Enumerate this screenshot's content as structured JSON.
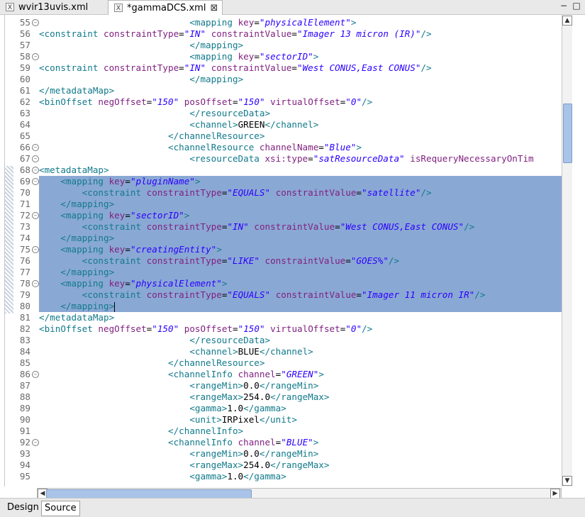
{
  "tabs": [
    {
      "label": "wvir13uvis.xml",
      "active": false
    },
    {
      "label": "*gammaDCS.xml",
      "active": true
    }
  ],
  "window_controls": [
    "minimize",
    "maximize"
  ],
  "bottom_tabs": [
    {
      "label": "Design",
      "active": false
    },
    {
      "label": "Source",
      "active": true
    }
  ],
  "editor": {
    "selection": {
      "from_line": 69,
      "to_line": 80
    },
    "caret_line": 80,
    "lines": [
      {
        "n": "55",
        "fold": true,
        "sel": false,
        "i": 28,
        "t": [
          [
            "t-tag",
            "<mapping "
          ],
          [
            "t-attr",
            "key"
          ],
          [
            "t-txt",
            "="
          ],
          [
            "t-val",
            "\"physicalElement\""
          ],
          [
            "t-tag",
            ">"
          ]
        ]
      },
      {
        "n": "56",
        "fold": false,
        "sel": false,
        "i": 0,
        "t": [
          [
            "t-tag",
            "<constraint "
          ],
          [
            "t-attr",
            "constraintType"
          ],
          [
            "t-txt",
            "="
          ],
          [
            "t-val",
            "\"IN\""
          ],
          [
            "t-txt",
            " "
          ],
          [
            "t-attr",
            "constraintValue"
          ],
          [
            "t-txt",
            "="
          ],
          [
            "t-val",
            "\"Imager 13 micron (IR)\""
          ],
          [
            "t-tag",
            "/>"
          ]
        ]
      },
      {
        "n": "57",
        "fold": false,
        "sel": false,
        "i": 28,
        "t": [
          [
            "t-tag",
            "</mapping>"
          ]
        ]
      },
      {
        "n": "58",
        "fold": true,
        "sel": false,
        "i": 28,
        "t": [
          [
            "t-tag",
            "<mapping "
          ],
          [
            "t-attr",
            "key"
          ],
          [
            "t-txt",
            "="
          ],
          [
            "t-val",
            "\"sectorID\""
          ],
          [
            "t-tag",
            ">"
          ]
        ]
      },
      {
        "n": "59",
        "fold": false,
        "sel": false,
        "i": 0,
        "t": [
          [
            "t-tag",
            "<constraint "
          ],
          [
            "t-attr",
            "constraintType"
          ],
          [
            "t-txt",
            "="
          ],
          [
            "t-val",
            "\"IN\""
          ],
          [
            "t-txt",
            " "
          ],
          [
            "t-attr",
            "constraintValue"
          ],
          [
            "t-txt",
            "="
          ],
          [
            "t-val",
            "\"West CONUS,East CONUS\""
          ],
          [
            "t-tag",
            "/>"
          ]
        ]
      },
      {
        "n": "60",
        "fold": false,
        "sel": false,
        "i": 28,
        "t": [
          [
            "t-tag",
            "</mapping>"
          ]
        ]
      },
      {
        "n": "61",
        "fold": false,
        "sel": false,
        "i": 0,
        "t": [
          [
            "t-tag",
            "</metadataMap>"
          ]
        ]
      },
      {
        "n": "62",
        "fold": false,
        "sel": false,
        "i": 0,
        "t": [
          [
            "t-tag",
            "<binOffset "
          ],
          [
            "t-attr",
            "negOffset"
          ],
          [
            "t-txt",
            "="
          ],
          [
            "t-val",
            "\"150\""
          ],
          [
            "t-txt",
            " "
          ],
          [
            "t-attr",
            "posOffset"
          ],
          [
            "t-txt",
            "="
          ],
          [
            "t-val",
            "\"150\""
          ],
          [
            "t-txt",
            " "
          ],
          [
            "t-attr",
            "virtualOffset"
          ],
          [
            "t-txt",
            "="
          ],
          [
            "t-val",
            "\"0\""
          ],
          [
            "t-tag",
            "/>"
          ]
        ]
      },
      {
        "n": "63",
        "fold": false,
        "sel": false,
        "i": 28,
        "t": [
          [
            "t-tag",
            "</resourceData>"
          ]
        ]
      },
      {
        "n": "64",
        "fold": false,
        "sel": false,
        "i": 28,
        "t": [
          [
            "t-tag",
            "<channel>"
          ],
          [
            "t-txt",
            "GREEN"
          ],
          [
            "t-tag",
            "</channel>"
          ]
        ]
      },
      {
        "n": "65",
        "fold": false,
        "sel": false,
        "i": 24,
        "t": [
          [
            "t-tag",
            "</channelResource>"
          ]
        ]
      },
      {
        "n": "66",
        "fold": true,
        "sel": false,
        "i": 24,
        "t": [
          [
            "t-tag",
            "<channelResource "
          ],
          [
            "t-attr",
            "channelName"
          ],
          [
            "t-txt",
            "="
          ],
          [
            "t-val",
            "\"Blue\""
          ],
          [
            "t-tag",
            ">"
          ]
        ]
      },
      {
        "n": "67",
        "fold": true,
        "sel": false,
        "i": 28,
        "t": [
          [
            "t-tag",
            "<resourceData "
          ],
          [
            "t-attr",
            "xsi:type"
          ],
          [
            "t-txt",
            "="
          ],
          [
            "t-val",
            "\"satResourceData\""
          ],
          [
            "t-txt",
            " "
          ],
          [
            "t-attr",
            "isRequeryNecessaryOnTim"
          ]
        ]
      },
      {
        "n": "68",
        "fold": true,
        "sel": false,
        "i": 0,
        "t": [
          [
            "t-tag",
            "<metadataMap>"
          ]
        ]
      },
      {
        "n": "69",
        "fold": true,
        "sel": true,
        "i": 4,
        "t": [
          [
            "t-tag",
            "<mapping "
          ],
          [
            "t-attr",
            "key"
          ],
          [
            "t-txt",
            "="
          ],
          [
            "t-val",
            "\"pluginName\""
          ],
          [
            "t-tag",
            ">"
          ]
        ]
      },
      {
        "n": "70",
        "fold": false,
        "sel": true,
        "i": 8,
        "t": [
          [
            "t-tag",
            "<constraint "
          ],
          [
            "t-attr",
            "constraintType"
          ],
          [
            "t-txt",
            "="
          ],
          [
            "t-val",
            "\"EQUALS\""
          ],
          [
            "t-txt",
            " "
          ],
          [
            "t-attr",
            "constraintValue"
          ],
          [
            "t-txt",
            "="
          ],
          [
            "t-val",
            "\"satellite\""
          ],
          [
            "t-tag",
            "/>"
          ]
        ]
      },
      {
        "n": "71",
        "fold": false,
        "sel": true,
        "i": 4,
        "t": [
          [
            "t-tag",
            "</mapping>"
          ]
        ]
      },
      {
        "n": "72",
        "fold": true,
        "sel": true,
        "i": 4,
        "t": [
          [
            "t-tag",
            "<mapping "
          ],
          [
            "t-attr",
            "key"
          ],
          [
            "t-txt",
            "="
          ],
          [
            "t-val",
            "\"sectorID\""
          ],
          [
            "t-tag",
            ">"
          ]
        ]
      },
      {
        "n": "73",
        "fold": false,
        "sel": true,
        "i": 8,
        "t": [
          [
            "t-tag",
            "<constraint "
          ],
          [
            "t-attr",
            "constraintType"
          ],
          [
            "t-txt",
            "="
          ],
          [
            "t-val",
            "\"IN\""
          ],
          [
            "t-txt",
            " "
          ],
          [
            "t-attr",
            "constraintValue"
          ],
          [
            "t-txt",
            "="
          ],
          [
            "t-val",
            "\"West CONUS,East CONUS\""
          ],
          [
            "t-tag",
            "/>"
          ]
        ]
      },
      {
        "n": "74",
        "fold": false,
        "sel": true,
        "i": 4,
        "t": [
          [
            "t-tag",
            "</mapping>"
          ]
        ]
      },
      {
        "n": "75",
        "fold": true,
        "sel": true,
        "i": 4,
        "t": [
          [
            "t-tag",
            "<mapping "
          ],
          [
            "t-attr",
            "key"
          ],
          [
            "t-txt",
            "="
          ],
          [
            "t-val",
            "\"creatingEntity\""
          ],
          [
            "t-tag",
            ">"
          ]
        ]
      },
      {
        "n": "76",
        "fold": false,
        "sel": true,
        "i": 8,
        "t": [
          [
            "t-tag",
            "<constraint "
          ],
          [
            "t-attr",
            "constraintType"
          ],
          [
            "t-txt",
            "="
          ],
          [
            "t-val",
            "\"LIKE\""
          ],
          [
            "t-txt",
            " "
          ],
          [
            "t-attr",
            "constraintValue"
          ],
          [
            "t-txt",
            "="
          ],
          [
            "t-val",
            "\"GOES%\""
          ],
          [
            "t-tag",
            "/>"
          ]
        ]
      },
      {
        "n": "77",
        "fold": false,
        "sel": true,
        "i": 4,
        "t": [
          [
            "t-tag",
            "</mapping>"
          ]
        ]
      },
      {
        "n": "78",
        "fold": true,
        "sel": true,
        "i": 4,
        "t": [
          [
            "t-tag",
            "<mapping "
          ],
          [
            "t-attr",
            "key"
          ],
          [
            "t-txt",
            "="
          ],
          [
            "t-val",
            "\"physicalElement\""
          ],
          [
            "t-tag",
            ">"
          ]
        ]
      },
      {
        "n": "79",
        "fold": false,
        "sel": true,
        "i": 8,
        "t": [
          [
            "t-tag",
            "<constraint "
          ],
          [
            "t-attr",
            "constraintType"
          ],
          [
            "t-txt",
            "="
          ],
          [
            "t-val",
            "\"EQUALS\""
          ],
          [
            "t-txt",
            " "
          ],
          [
            "t-attr",
            "constraintValue"
          ],
          [
            "t-txt",
            "="
          ],
          [
            "t-val",
            "\"Imager 11 micron IR\""
          ],
          [
            "t-tag",
            "/>"
          ]
        ]
      },
      {
        "n": "80",
        "fold": false,
        "sel": true,
        "i": 4,
        "t": [
          [
            "t-tag",
            "</mapping>"
          ]
        ]
      },
      {
        "n": "81",
        "fold": false,
        "sel": false,
        "i": 0,
        "t": [
          [
            "t-tag",
            "</metadataMap>"
          ]
        ]
      },
      {
        "n": "82",
        "fold": false,
        "sel": false,
        "i": 0,
        "t": [
          [
            "t-tag",
            "<binOffset "
          ],
          [
            "t-attr",
            "negOffset"
          ],
          [
            "t-txt",
            "="
          ],
          [
            "t-val",
            "\"150\""
          ],
          [
            "t-txt",
            " "
          ],
          [
            "t-attr",
            "posOffset"
          ],
          [
            "t-txt",
            "="
          ],
          [
            "t-val",
            "\"150\""
          ],
          [
            "t-txt",
            " "
          ],
          [
            "t-attr",
            "virtualOffset"
          ],
          [
            "t-txt",
            "="
          ],
          [
            "t-val",
            "\"0\""
          ],
          [
            "t-tag",
            "/>"
          ]
        ]
      },
      {
        "n": "83",
        "fold": false,
        "sel": false,
        "i": 28,
        "t": [
          [
            "t-tag",
            "</resourceData>"
          ]
        ]
      },
      {
        "n": "84",
        "fold": false,
        "sel": false,
        "i": 28,
        "t": [
          [
            "t-tag",
            "<channel>"
          ],
          [
            "t-txt",
            "BLUE"
          ],
          [
            "t-tag",
            "</channel>"
          ]
        ]
      },
      {
        "n": "85",
        "fold": false,
        "sel": false,
        "i": 24,
        "t": [
          [
            "t-tag",
            "</channelResource>"
          ]
        ]
      },
      {
        "n": "86",
        "fold": true,
        "sel": false,
        "i": 24,
        "t": [
          [
            "t-tag",
            "<channelInfo "
          ],
          [
            "t-attr",
            "channel"
          ],
          [
            "t-txt",
            "="
          ],
          [
            "t-val",
            "\"GREEN\""
          ],
          [
            "t-tag",
            ">"
          ]
        ]
      },
      {
        "n": "87",
        "fold": false,
        "sel": false,
        "i": 28,
        "t": [
          [
            "t-tag",
            "<rangeMin>"
          ],
          [
            "t-txt",
            "0.0"
          ],
          [
            "t-tag",
            "</rangeMin>"
          ]
        ]
      },
      {
        "n": "88",
        "fold": false,
        "sel": false,
        "i": 28,
        "t": [
          [
            "t-tag",
            "<rangeMax>"
          ],
          [
            "t-txt",
            "254.0"
          ],
          [
            "t-tag",
            "</rangeMax>"
          ]
        ]
      },
      {
        "n": "89",
        "fold": false,
        "sel": false,
        "i": 28,
        "t": [
          [
            "t-tag",
            "<gamma>"
          ],
          [
            "t-txt",
            "1.0"
          ],
          [
            "t-tag",
            "</gamma>"
          ]
        ]
      },
      {
        "n": "90",
        "fold": false,
        "sel": false,
        "i": 28,
        "t": [
          [
            "t-tag",
            "<unit>"
          ],
          [
            "t-txt",
            "IRPixel"
          ],
          [
            "t-tag",
            "</unit>"
          ]
        ]
      },
      {
        "n": "91",
        "fold": false,
        "sel": false,
        "i": 24,
        "t": [
          [
            "t-tag",
            "</channelInfo>"
          ]
        ]
      },
      {
        "n": "92",
        "fold": true,
        "sel": false,
        "i": 24,
        "t": [
          [
            "t-tag",
            "<channelInfo "
          ],
          [
            "t-attr",
            "channel"
          ],
          [
            "t-txt",
            "="
          ],
          [
            "t-val",
            "\"BLUE\""
          ],
          [
            "t-tag",
            ">"
          ]
        ]
      },
      {
        "n": "93",
        "fold": false,
        "sel": false,
        "i": 28,
        "t": [
          [
            "t-tag",
            "<rangeMin>"
          ],
          [
            "t-txt",
            "0.0"
          ],
          [
            "t-tag",
            "</rangeMin>"
          ]
        ]
      },
      {
        "n": "94",
        "fold": false,
        "sel": false,
        "i": 28,
        "t": [
          [
            "t-tag",
            "<rangeMax>"
          ],
          [
            "t-txt",
            "254.0"
          ],
          [
            "t-tag",
            "</rangeMax>"
          ]
        ]
      },
      {
        "n": "95",
        "fold": false,
        "sel": false,
        "i": 28,
        "t": [
          [
            "t-tag",
            "<gamma>"
          ],
          [
            "t-txt",
            "1.0"
          ],
          [
            "t-tag",
            "</gamma>"
          ]
        ]
      }
    ]
  }
}
